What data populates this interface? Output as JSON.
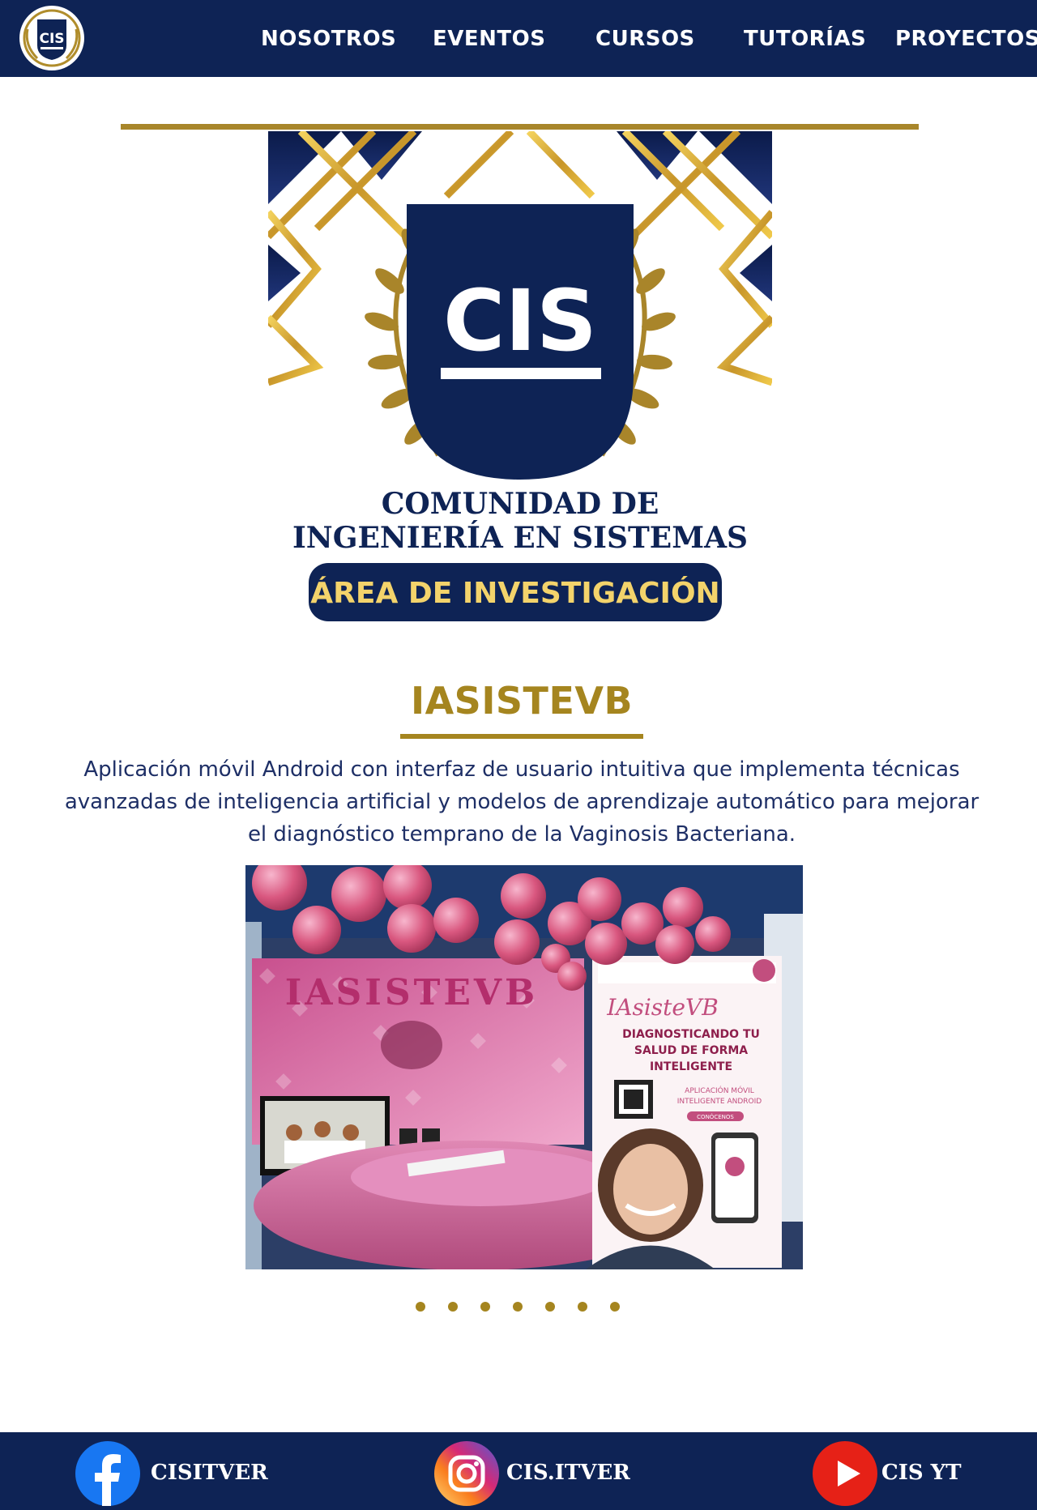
{
  "header": {
    "logo_text": "CIS",
    "nav": [
      {
        "label": "NOSOTROS"
      },
      {
        "label": "EVENTOS"
      },
      {
        "label": "CURSOS"
      },
      {
        "label": "TUTORÍAS"
      },
      {
        "label": "PROYECTOS"
      }
    ]
  },
  "hero": {
    "emblem_text": "CIS",
    "org_line1": "COMUNIDAD DE",
    "org_line2": "INGENIERÍA EN SISTEMAS",
    "area_pill": "ÁREA DE INVESTIGACIÓN"
  },
  "project": {
    "title": "IASISTEVB",
    "description": "Aplicación móvil Android con interfaz de usuario intuitiva que  implementa técnicas avanzadas de inteligencia artificial y modelos de aprendizaje  automático para mejorar el diagnóstico temprano de la Vaginosis Bacteriana.",
    "photo": {
      "backdrop_text": "IASISTEVB",
      "poster_script": "IAsisteVB",
      "poster_headline": [
        "DIAGNOSTICANDO TU",
        "SALUD DE FORMA",
        "INTELIGENTE"
      ],
      "poster_subtitle": [
        "APLICACIÓN MÓVIL",
        "INTELIGENTE ANDROID"
      ],
      "poster_button": "CONÓCENOS"
    }
  },
  "carousel": {
    "total": 7,
    "active": 0
  },
  "footer": {
    "social": [
      {
        "label": "CISITVER",
        "icon": "facebook-icon"
      },
      {
        "label": "CIS.ITVER",
        "icon": "instagram-icon"
      },
      {
        "label": "CIS YT",
        "icon": "youtube-icon"
      }
    ]
  },
  "colors": {
    "navy": "#0e2355",
    "gold": "#a5851f",
    "text": "#1e2f66",
    "pill_text": "#f3d36b"
  }
}
